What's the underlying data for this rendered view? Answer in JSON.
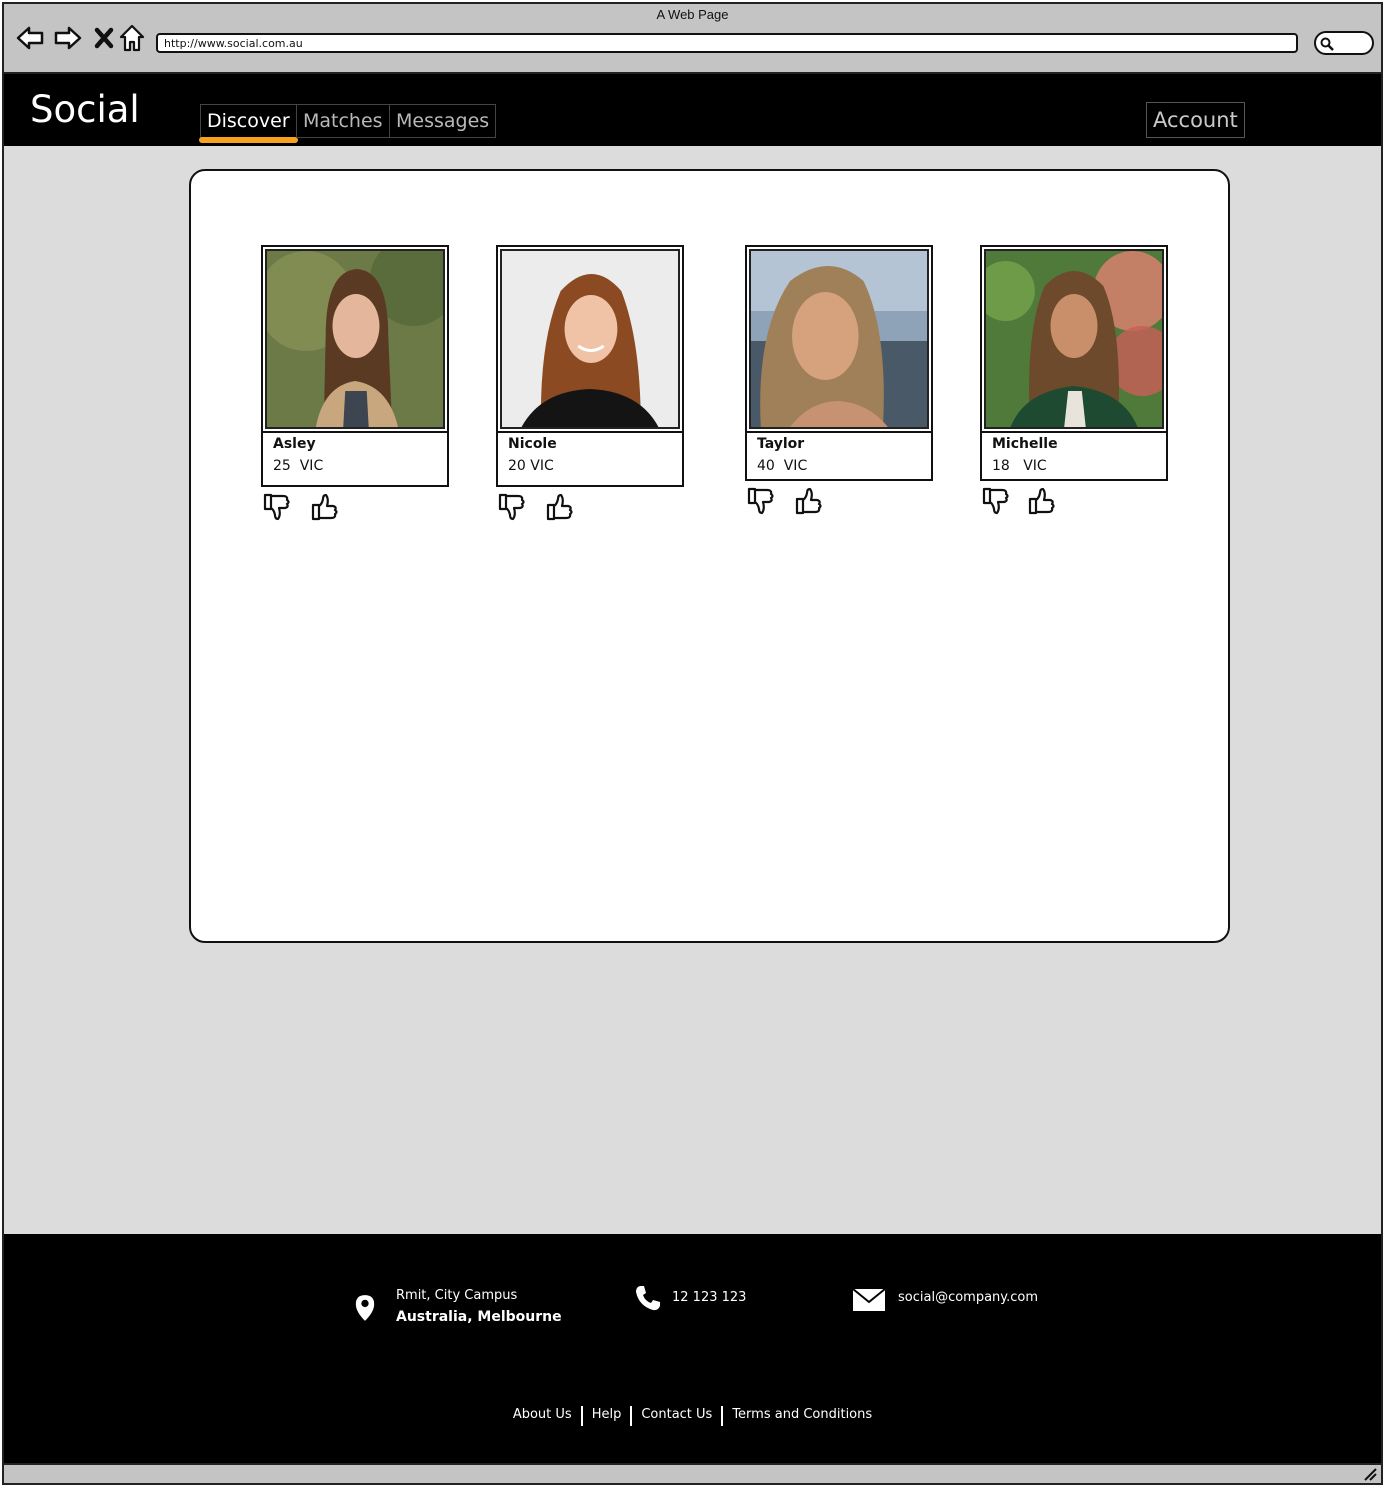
{
  "browser": {
    "title": "A Web Page",
    "url": "http://www.social.com.au"
  },
  "header": {
    "brand": "Social",
    "tabs": [
      {
        "label": "Discover",
        "active": true
      },
      {
        "label": "Matches",
        "active": false
      },
      {
        "label": "Messages",
        "active": false
      }
    ],
    "account_label": "Account",
    "accent_color": "#f7a21c"
  },
  "profiles": [
    {
      "name": "Asley",
      "age": "25",
      "state": "VIC"
    },
    {
      "name": "Nicole",
      "age": "20",
      "state": "VIC"
    },
    {
      "name": "Taylor",
      "age": "40",
      "state": "VIC"
    },
    {
      "name": "Michelle",
      "age": "18",
      "state": "VIC"
    }
  ],
  "actions": {
    "dislike_icon": "thumbs-down-icon",
    "like_icon": "thumbs-up-icon"
  },
  "footer": {
    "address_line1": "Rmit, City Campus",
    "address_line2": "Australia, Melbourne",
    "phone": "12 123 123",
    "email": "social@company.com",
    "links": [
      "About Us",
      "Help",
      "Contact Us",
      "Terms and Conditions"
    ]
  }
}
